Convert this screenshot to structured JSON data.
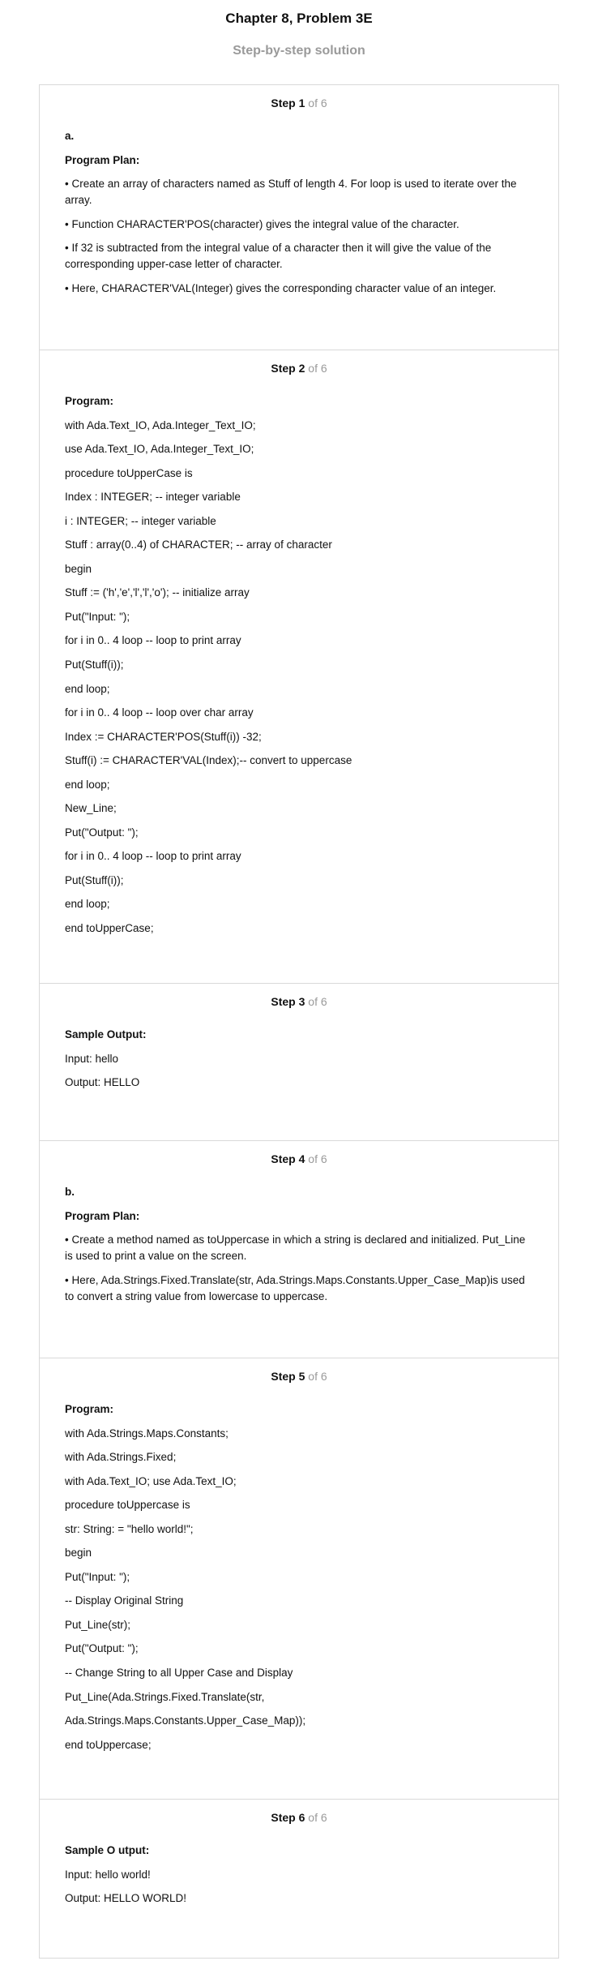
{
  "header": {
    "title": "Chapter 8, Problem 3E",
    "subtitle": "Step-by-step solution"
  },
  "step_label_word": "Step",
  "steps": [
    {
      "number": "1",
      "of_total": "of 6",
      "part": "a.",
      "heading": "Program Plan:",
      "bullets": [
        "• Create an array of characters named as Stuff of length 4. For loop is used to iterate over the array.",
        "• Function CHARACTER'POS(character) gives the integral value of the character.",
        "• If 32 is subtracted from the integral value of a character then it will give the value of the corresponding upper-case letter of character.",
        "• Here, CHARACTER'VAL(Integer) gives the corresponding character value of an integer."
      ]
    },
    {
      "number": "2",
      "of_total": "of 6",
      "heading": "Program:",
      "lines": [
        "with Ada.Text_IO, Ada.Integer_Text_IO;",
        "use Ada.Text_IO, Ada.Integer_Text_IO;",
        "procedure toUpperCase is",
        "Index : INTEGER; -- integer variable",
        "i : INTEGER; -- integer variable",
        "Stuff : array(0..4) of CHARACTER; -- array of character",
        "begin",
        "Stuff := ('h','e','l','l','o'); -- initialize array",
        "Put(\"Input: \");",
        "for i in 0.. 4 loop -- loop to print array",
        "Put(Stuff(i));",
        "end loop;",
        "for i in 0.. 4 loop -- loop over char array",
        "Index := CHARACTER'POS(Stuff(i)) -32;",
        "Stuff(i) := CHARACTER'VAL(Index);-- convert to uppercase",
        "end loop;",
        "New_Line;",
        "Put(\"Output: \");",
        "for i in 0.. 4 loop -- loop to print array",
        "Put(Stuff(i));",
        "end loop;",
        "end toUpperCase;"
      ]
    },
    {
      "number": "3",
      "of_total": "of 6",
      "heading": "Sample Output:",
      "lines": [
        "Input: hello",
        "Output: HELLO"
      ]
    },
    {
      "number": "4",
      "of_total": "of 6",
      "part": "b.",
      "heading": "Program Plan:",
      "bullets": [
        "• Create a method named as toUppercase in which a string is declared and initialized. Put_Line is used to print a value on the screen.",
        "• Here, Ada.Strings.Fixed.Translate(str, Ada.Strings.Maps.Constants.Upper_Case_Map)is used to convert a string value from lowercase to uppercase."
      ]
    },
    {
      "number": "5",
      "of_total": "of 6",
      "heading": "Program:",
      "lines": [
        "with Ada.Strings.Maps.Constants;",
        "with Ada.Strings.Fixed;",
        "with Ada.Text_IO; use Ada.Text_IO;",
        "procedure toUppercase is",
        "str: String: = \"hello world!\";",
        "begin",
        "Put(\"Input: \");",
        "-- Display Original String",
        "Put_Line(str);",
        "Put(\"Output: \");",
        "-- Change String to all Upper Case and Display",
        "Put_Line(Ada.Strings.Fixed.Translate(str,",
        "Ada.Strings.Maps.Constants.Upper_Case_Map));",
        "end toUppercase;"
      ]
    },
    {
      "number": "6",
      "of_total": "of 6",
      "heading": "Sample O utput:",
      "lines": [
        "Input: hello world!",
        "Output: HELLO WORLD!"
      ]
    }
  ]
}
